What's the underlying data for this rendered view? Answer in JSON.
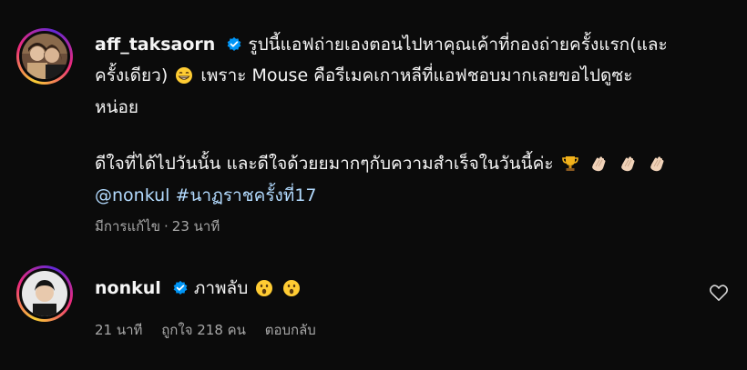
{
  "comments": [
    {
      "username": "aff_taksaorn",
      "verified": true,
      "line1_text": "รูปนี้แอฟถ่ายเองตอนไปหาคุณเค้าที่กองถ่ายครั้งแรก(และ",
      "line2_text_a": "ครั้งเดียว)",
      "line2_text_b": "เพราะ Mouse คือรีเมคเกาหลีที่แอฟชอบมากเลยขอไปดูซะ",
      "line3_text": "หน่อย",
      "line4_text": "ดีใจที่ได้ไปวันนั้น และดีใจด้วยยมากๆกับความสำเร็จในวันนี้ค่ะ",
      "mention": "@nonkul",
      "hashtag": "#นาฏราชครั้งที่17",
      "edited_label": "มีการแก้ไข",
      "separator": "·",
      "time": "23 นาที",
      "emojis": [
        "grin-emoji",
        "trophy-emoji",
        "clap-emoji",
        "clap-emoji",
        "clap-emoji"
      ]
    },
    {
      "username": "nonkul",
      "verified": true,
      "text": "ภาพลับ",
      "emojis": [
        "surprised-emoji",
        "surprised-emoji"
      ],
      "time": "21 นาที",
      "likes_label": "ถูกใจ 218 คน",
      "reply_label": "ตอบกลับ"
    }
  ],
  "colors": {
    "background": "#0b0b0b",
    "verified": "#0095f6",
    "link": "#b3dbff",
    "muted": "#a8a8a8"
  }
}
